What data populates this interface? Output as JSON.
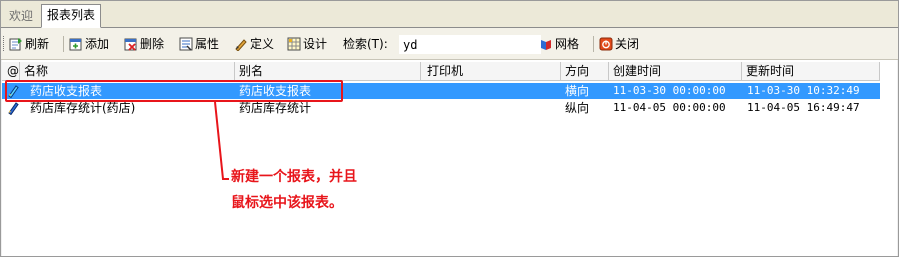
{
  "tabs": [
    {
      "label": "欢迎",
      "active": false
    },
    {
      "label": "报表列表",
      "active": true
    }
  ],
  "toolbar": {
    "refresh_label": "刷新",
    "add_label": "添加",
    "delete_label": "删除",
    "properties_label": "属性",
    "define_label": "定义",
    "design_label": "设计",
    "search_label": "检索(T):",
    "search_value": "yd",
    "grid_label": "网格",
    "close_label": "关闭"
  },
  "table": {
    "columns": [
      "@",
      "名称",
      "别名",
      "打印机",
      "方向",
      "创建时间",
      "更新时间"
    ],
    "rows": [
      {
        "name": "药店收支报表",
        "alias": "药店收支报表",
        "printer": "",
        "orientation": "横向",
        "created": "11-03-30 00:00:00",
        "updated": "11-03-30 10:32:49",
        "selected": true
      },
      {
        "name": "药店库存统计(药店)",
        "alias": "药店库存统计",
        "printer": "",
        "orientation": "纵向",
        "created": "11-04-05 00:00:00",
        "updated": "11-04-05 16:49:47",
        "selected": false
      }
    ]
  },
  "annotation": {
    "line1": "新建一个报表，并且",
    "line2": "鼠标选中该报表。",
    "color": "#e8151b"
  },
  "colors": {
    "selection": "#3399ff",
    "accent_red": "#e8151b"
  },
  "icons": [
    "refresh-icon",
    "add-icon",
    "delete-icon",
    "properties-icon",
    "define-icon",
    "design-icon",
    "grid-icon",
    "close-icon",
    "report-icon"
  ]
}
